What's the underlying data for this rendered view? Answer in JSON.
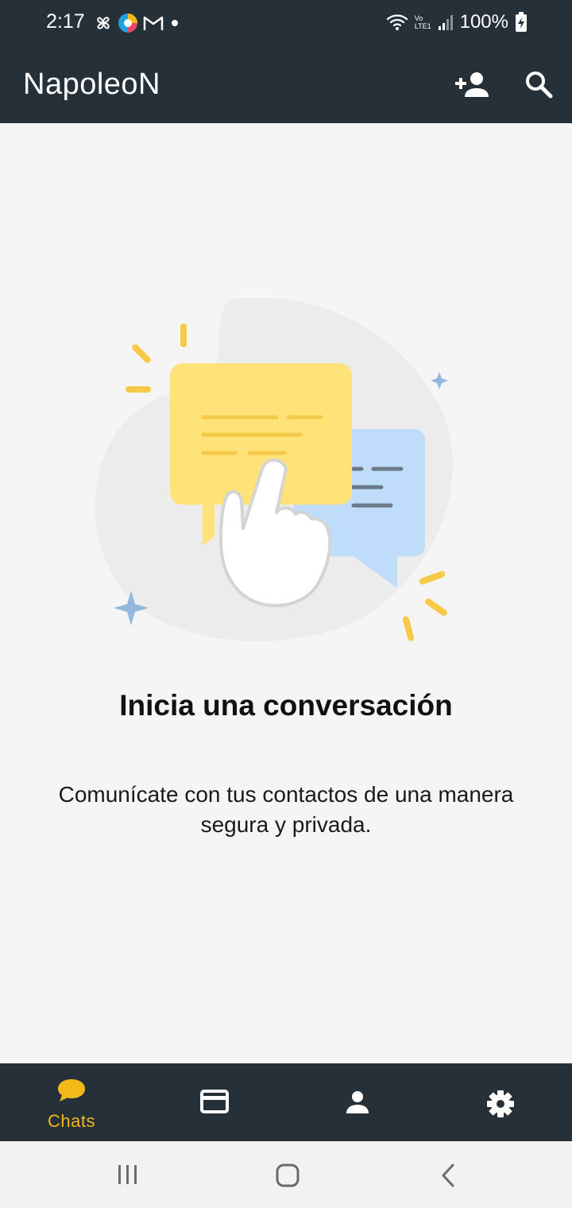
{
  "status_bar": {
    "time": "2:17",
    "battery": "100%",
    "left_icons": [
      "pinwheel-icon",
      "browser-icon",
      "gmail-icon",
      "notification-dot-icon"
    ],
    "right_icons": [
      "wifi-icon",
      "volte-icon",
      "signal-icon",
      "battery-charging-icon"
    ],
    "volte_label": "Vo",
    "lte_label": "LTE1"
  },
  "app_bar": {
    "title": "NapoleoN",
    "actions": [
      "add-contact-icon",
      "search-icon"
    ]
  },
  "empty_state": {
    "title": "Inicia una conversación",
    "description": "Comunícate con tus contactos de una manera segura y privada.",
    "illustration": "chat-bubbles-tap-illustration"
  },
  "bottom_nav": {
    "items": [
      {
        "label": "Chats",
        "icon": "chat-bubble-icon",
        "active": true
      },
      {
        "label": "",
        "icon": "card-icon",
        "active": false
      },
      {
        "label": "",
        "icon": "person-icon",
        "active": false
      },
      {
        "label": "",
        "icon": "gear-icon",
        "active": false
      }
    ]
  },
  "system_nav": [
    "recents-icon",
    "home-icon",
    "back-icon"
  ],
  "colors": {
    "bar": "#263038",
    "background": "#f5f5f5",
    "accent": "#f2b918",
    "yellow_bubble": "#ffe278",
    "blue_bubble": "#bfdcfb"
  }
}
